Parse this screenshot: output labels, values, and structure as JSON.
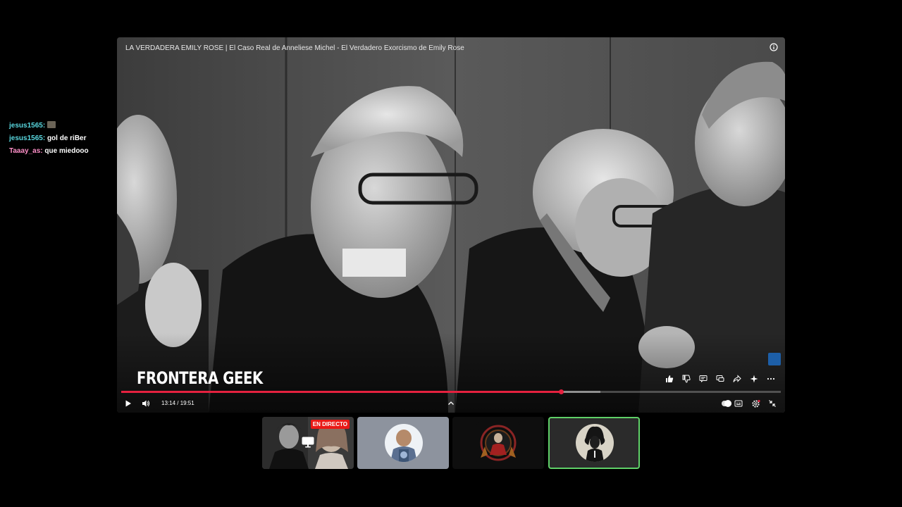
{
  "chat": {
    "messages": [
      {
        "user": "jesus1565:",
        "text": "",
        "user_color": "#59d8e0",
        "emote": "emote-icon"
      },
      {
        "user": "jesus1565:",
        "text": "gol de riBer",
        "user_color": "#59d8e0"
      },
      {
        "user": "Taaay_as:",
        "text": "que miedooo",
        "user_color": "#ff8fc8"
      }
    ]
  },
  "player": {
    "title": "LA VERDADERA EMILY ROSE | El Caso Real de Anneliese Michel - El Verdadero Exorcismo de Emily Rose",
    "watermark": "FRONTERA GEEK",
    "time": "13:14 / 19:51",
    "progress_fraction": 0.667,
    "buffer_fraction": 0.726,
    "accent_color": "#e5213f",
    "actions": [
      "like-icon",
      "dislike-icon",
      "comments-icon",
      "chat-icon",
      "share-icon",
      "sparkle-icon",
      "more-icon"
    ],
    "controls_right": [
      "autoplay-toggle",
      "captions-icon",
      "settings-icon",
      "exit-fullscreen-icon"
    ]
  },
  "tiles": {
    "live_label": "EN DIRECTO",
    "live_color": "#e91916",
    "active_border": "#5fd068",
    "items": [
      {
        "name": "tile-live-stream",
        "icon": "screen-share-icon"
      },
      {
        "name": "tile-user-2",
        "icon": "avatar"
      },
      {
        "name": "tile-user-3",
        "icon": "avatar"
      },
      {
        "name": "tile-user-4",
        "icon": "avatar"
      }
    ]
  }
}
